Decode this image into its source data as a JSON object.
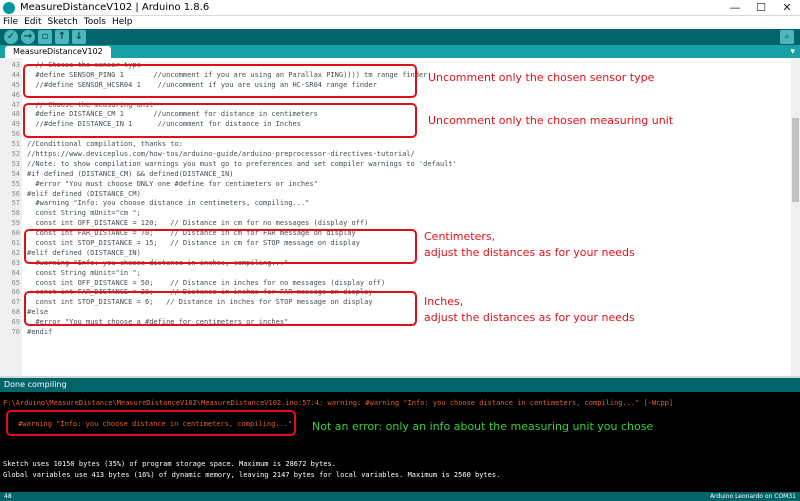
{
  "window": {
    "title": "MeasureDistanceV102 | Arduino 1.8.6",
    "minimize": "—",
    "maximize": "☐",
    "close": "✕"
  },
  "menu": [
    "File",
    "Edit",
    "Sketch",
    "Tools",
    "Help"
  ],
  "toolbar": {
    "verify": "✓",
    "upload": "→",
    "new": "▫",
    "open": "↑",
    "save": "↓",
    "serial_monitor": "⌕"
  },
  "tab": {
    "label": "MeasureDistanceV102",
    "menu": "▾"
  },
  "code": [
    {
      "n": "43",
      "t": "  // Choose the sensor type"
    },
    {
      "n": "44",
      "t": "  #define SENSOR_PING 1       //uncomment if you are using an Parallax PING)))) tm range finder"
    },
    {
      "n": "45",
      "t": "  //#define SENSOR_HCSR04 1    //uncomment if you are using an HC-SR04 range finder"
    },
    {
      "n": "46",
      "t": ""
    },
    {
      "n": "47",
      "t": "  // Choose the measuring unit"
    },
    {
      "n": "48",
      "t": "  #define DISTANCE_CM 1       //uncomment for distance in centimeters"
    },
    {
      "n": "49",
      "t": "  //#define DISTANCE_IN 1      //uncomment for distance in Inches"
    },
    {
      "n": "50",
      "t": ""
    },
    {
      "n": "51",
      "t": "//Conditional compilation, thanks to:"
    },
    {
      "n": "52",
      "t": "//https://www.deviceplus.com/how-tos/arduino-guide/arduino-preprocessor-directives-tutorial/"
    },
    {
      "n": "53",
      "t": "//Note: to show compilation warnings you must go to preferences and set compiler warnings to 'default'"
    },
    {
      "n": "54",
      "t": "#if defined (DISTANCE_CM) && defined(DISTANCE_IN)"
    },
    {
      "n": "55",
      "t": "  #error \"You must choose ONLY one #define for centimeters or inches\""
    },
    {
      "n": "56",
      "t": "#elif defined (DISTANCE_CM)"
    },
    {
      "n": "57",
      "t": "  #warning \"Info: you choose distance in centimeters, compiling...\""
    },
    {
      "n": "58",
      "t": "  const String mUnit=\"cm \";"
    },
    {
      "n": "59",
      "t": "  const int OFF_DISTANCE = 120;   // Distance in cm for no messages (display off)"
    },
    {
      "n": "60",
      "t": "  const int FAR_DISTANCE = 70;    // Distance in cm for FAR message on display"
    },
    {
      "n": "61",
      "t": "  const int STOP_DISTANCE = 15;   // Distance in cm for STOP message on display"
    },
    {
      "n": "62",
      "t": "#elif defined (DISTANCE_IN)"
    },
    {
      "n": "63",
      "t": "  #warning \"Info: you choose distance in inches, compiling...\""
    },
    {
      "n": "64",
      "t": "  const String mUnit=\"in \";"
    },
    {
      "n": "65",
      "t": "  const int OFF_DISTANCE = 50;    // Distance in inches for no messages (display off)"
    },
    {
      "n": "66",
      "t": "  const int FAR_DISTANCE = 28;    // Distance in inches for FAR message on display"
    },
    {
      "n": "67",
      "t": "  const int STOP_DISTANCE = 6;   // Distance in inches for STOP message on display"
    },
    {
      "n": "68",
      "t": "#else"
    },
    {
      "n": "69",
      "t": "  #error \"You must choose a #define for centimeters or inches\""
    },
    {
      "n": "70",
      "t": "#endif"
    }
  ],
  "annotations": {
    "sensor": "Uncomment only the chosen sensor type",
    "unit": "Uncomment only the chosen measuring unit",
    "cm_1": "Centimeters,",
    "cm_2": "adjust the distances as for your needs",
    "in_1": "Inches,",
    "in_2": "adjust the distances as for your needs",
    "console": "Not an error: only an info about the measuring unit you chose"
  },
  "status": "Done compiling",
  "console": {
    "warning_path": "F:\\Arduino\\MeasureDistance\\MeasureDistanceV102\\MeasureDistanceV102.ino:57:4: warning: #warning \"Info: you choose distance in centimeters, compiling...\" [-Wcpp]",
    "warning_line": " #warning \"Info: you choose distance in centimeters, compiling...\"",
    "sketch_size": "Sketch uses 10150 bytes (35%) of program storage space. Maximum is 28672 bytes.",
    "globals": "Global variables use 413 bytes (16%) of dynamic memory, leaving 2147 bytes for local variables. Maximum is 2560 bytes."
  },
  "footer": {
    "line": "48",
    "board": "Arduino Leonardo on COM31"
  },
  "colors": {
    "teal_dark": "#006468",
    "teal_tab": "#17a1a5",
    "annotation_red": "#e0101a",
    "console_warn": "#e35f2f",
    "console_note": "#38d236"
  }
}
